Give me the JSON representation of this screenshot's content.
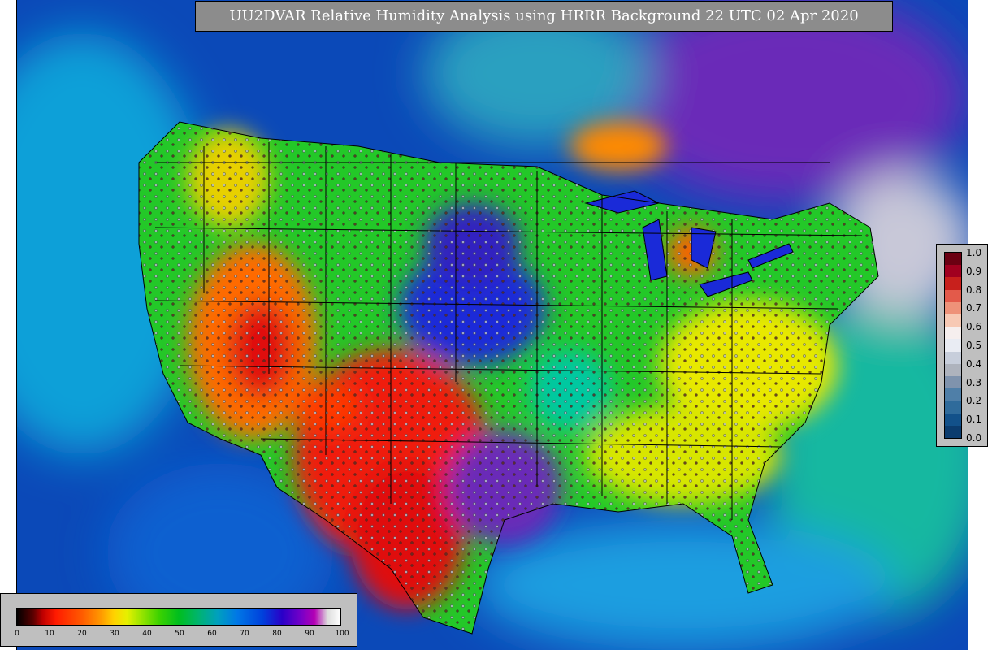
{
  "title": "UU2DVAR Relative Humidity Analysis using HRRR Background 22 UTC 02 Apr 2020",
  "bottom_colorbar": {
    "ticks": [
      "0",
      "10",
      "20",
      "30",
      "40",
      "50",
      "60",
      "70",
      "80",
      "90",
      "100"
    ]
  },
  "right_colorbar": {
    "ticks": [
      "1.0",
      "0.9",
      "0.8",
      "0.7",
      "0.6",
      "0.5",
      "0.4",
      "0.3",
      "0.2",
      "0.1",
      "0.0"
    ],
    "colors": [
      "#6b0012",
      "#a1001f",
      "#c8201c",
      "#e35a4a",
      "#ee9279",
      "#f7c9b4",
      "#f6efee",
      "#e9ecf3",
      "#c7cedb",
      "#aeb3bd",
      "#7f93ad",
      "#4f7fa8",
      "#2f6b9b",
      "#12518a",
      "#0b3c6e"
    ]
  },
  "colors": {
    "ocean": "#0b49b8",
    "dry": "#f01a0a",
    "moist": "#1fc81f"
  }
}
